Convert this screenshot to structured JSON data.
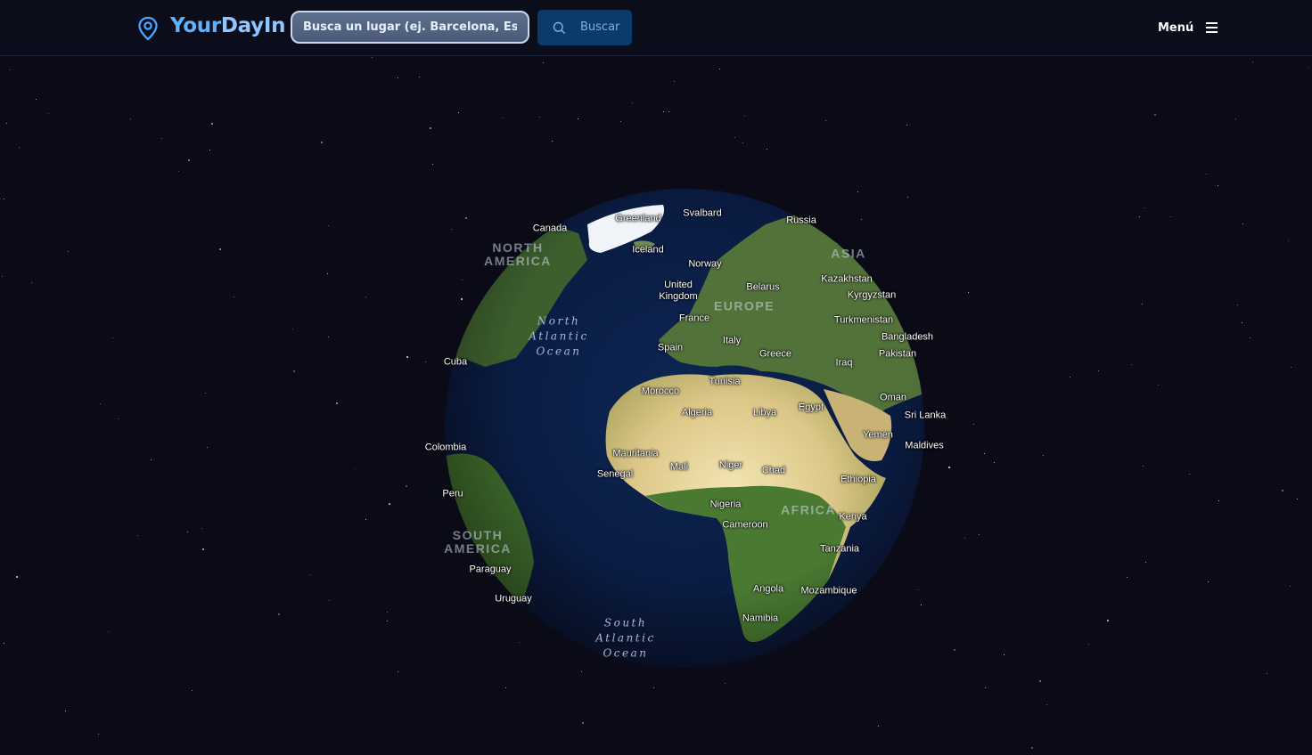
{
  "header": {
    "logo_text_part1": "Your",
    "logo_text_part2": "DayIn",
    "search_placeholder": "Busca un lugar (ej. Barcelona, España)",
    "search_button_label": "Buscar",
    "menu_label": "Menú"
  },
  "colors": {
    "background": "#0a0b16",
    "accent": "#5fb2ff",
    "search_button_bg": "#0b3b6a",
    "ocean": "#0a1e46"
  },
  "icons": {
    "logo": "map-pin-icon",
    "search": "search-icon",
    "menu": "hamburger-menu-icon"
  },
  "map": {
    "country_labels": [
      "Canada",
      "Greenland",
      "Svalbard",
      "Russia",
      "Iceland",
      "Norway",
      "United Kingdom",
      "Belarus",
      "Kazakhstan",
      "Kyrgyzstan",
      "France",
      "Turkmenistan",
      "Italy",
      "Bangladesh",
      "Spain",
      "Pakistan",
      "Greece",
      "Iraq",
      "Cuba",
      "Tunisia",
      "Morocco",
      "Oman",
      "Algeria",
      "Libya",
      "Egypt",
      "Sri Lanka",
      "Yemen",
      "Maldives",
      "Colombia",
      "Mauritania",
      "Mali",
      "Niger",
      "Chad",
      "Senegal",
      "Ethiopia",
      "Peru",
      "Nigeria",
      "Kenya",
      "Cameroon",
      "Tanzania",
      "Paraguay",
      "Angola",
      "Mozambique",
      "Uruguay",
      "Namibia"
    ],
    "continent_labels": [
      "NORTH AMERICA",
      "ASIA",
      "EUROPE",
      "AFRICA",
      "SOUTH AMERICA"
    ],
    "ocean_labels": [
      "North Atlantic Ocean",
      "South Atlantic Ocean"
    ]
  }
}
